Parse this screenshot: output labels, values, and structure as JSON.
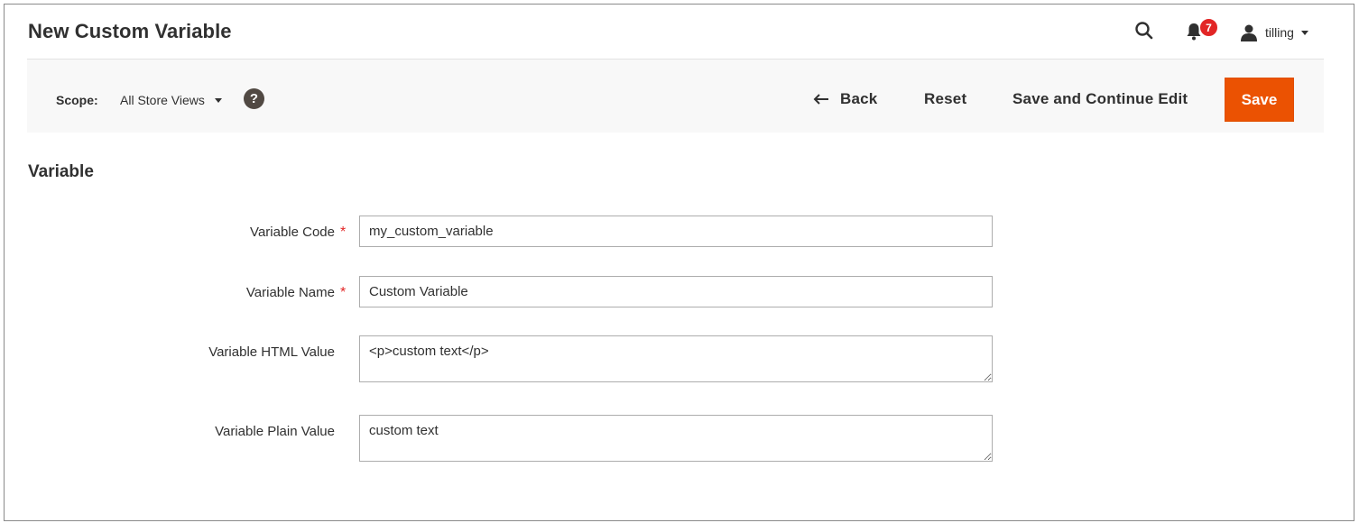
{
  "header": {
    "title": "New Custom Variable",
    "notifications_count": "7",
    "user_name": "tilling",
    "icons": {
      "search": "search-icon",
      "bell": "bell-icon",
      "user": "user-icon"
    }
  },
  "toolbar": {
    "scope_label": "Scope:",
    "scope_value": "All Store Views",
    "help_label": "?",
    "back_label": "Back",
    "reset_label": "Reset",
    "save_continue_label": "Save and Continue Edit",
    "save_label": "Save"
  },
  "form": {
    "section_title": "Variable",
    "required_marker": "*",
    "fields": [
      {
        "label": "Variable Code",
        "value": "my_custom_variable",
        "required": true
      },
      {
        "label": "Variable Name",
        "value": "Custom Variable",
        "required": true
      },
      {
        "label": "Variable HTML Value",
        "value": "<p>custom text</p>",
        "required": false
      },
      {
        "label": "Variable Plain Value",
        "value": "custom text",
        "required": false
      }
    ]
  },
  "colors": {
    "accent": "#eb5202",
    "badge": "#e22626",
    "required": "#e22626",
    "text": "#303030"
  }
}
